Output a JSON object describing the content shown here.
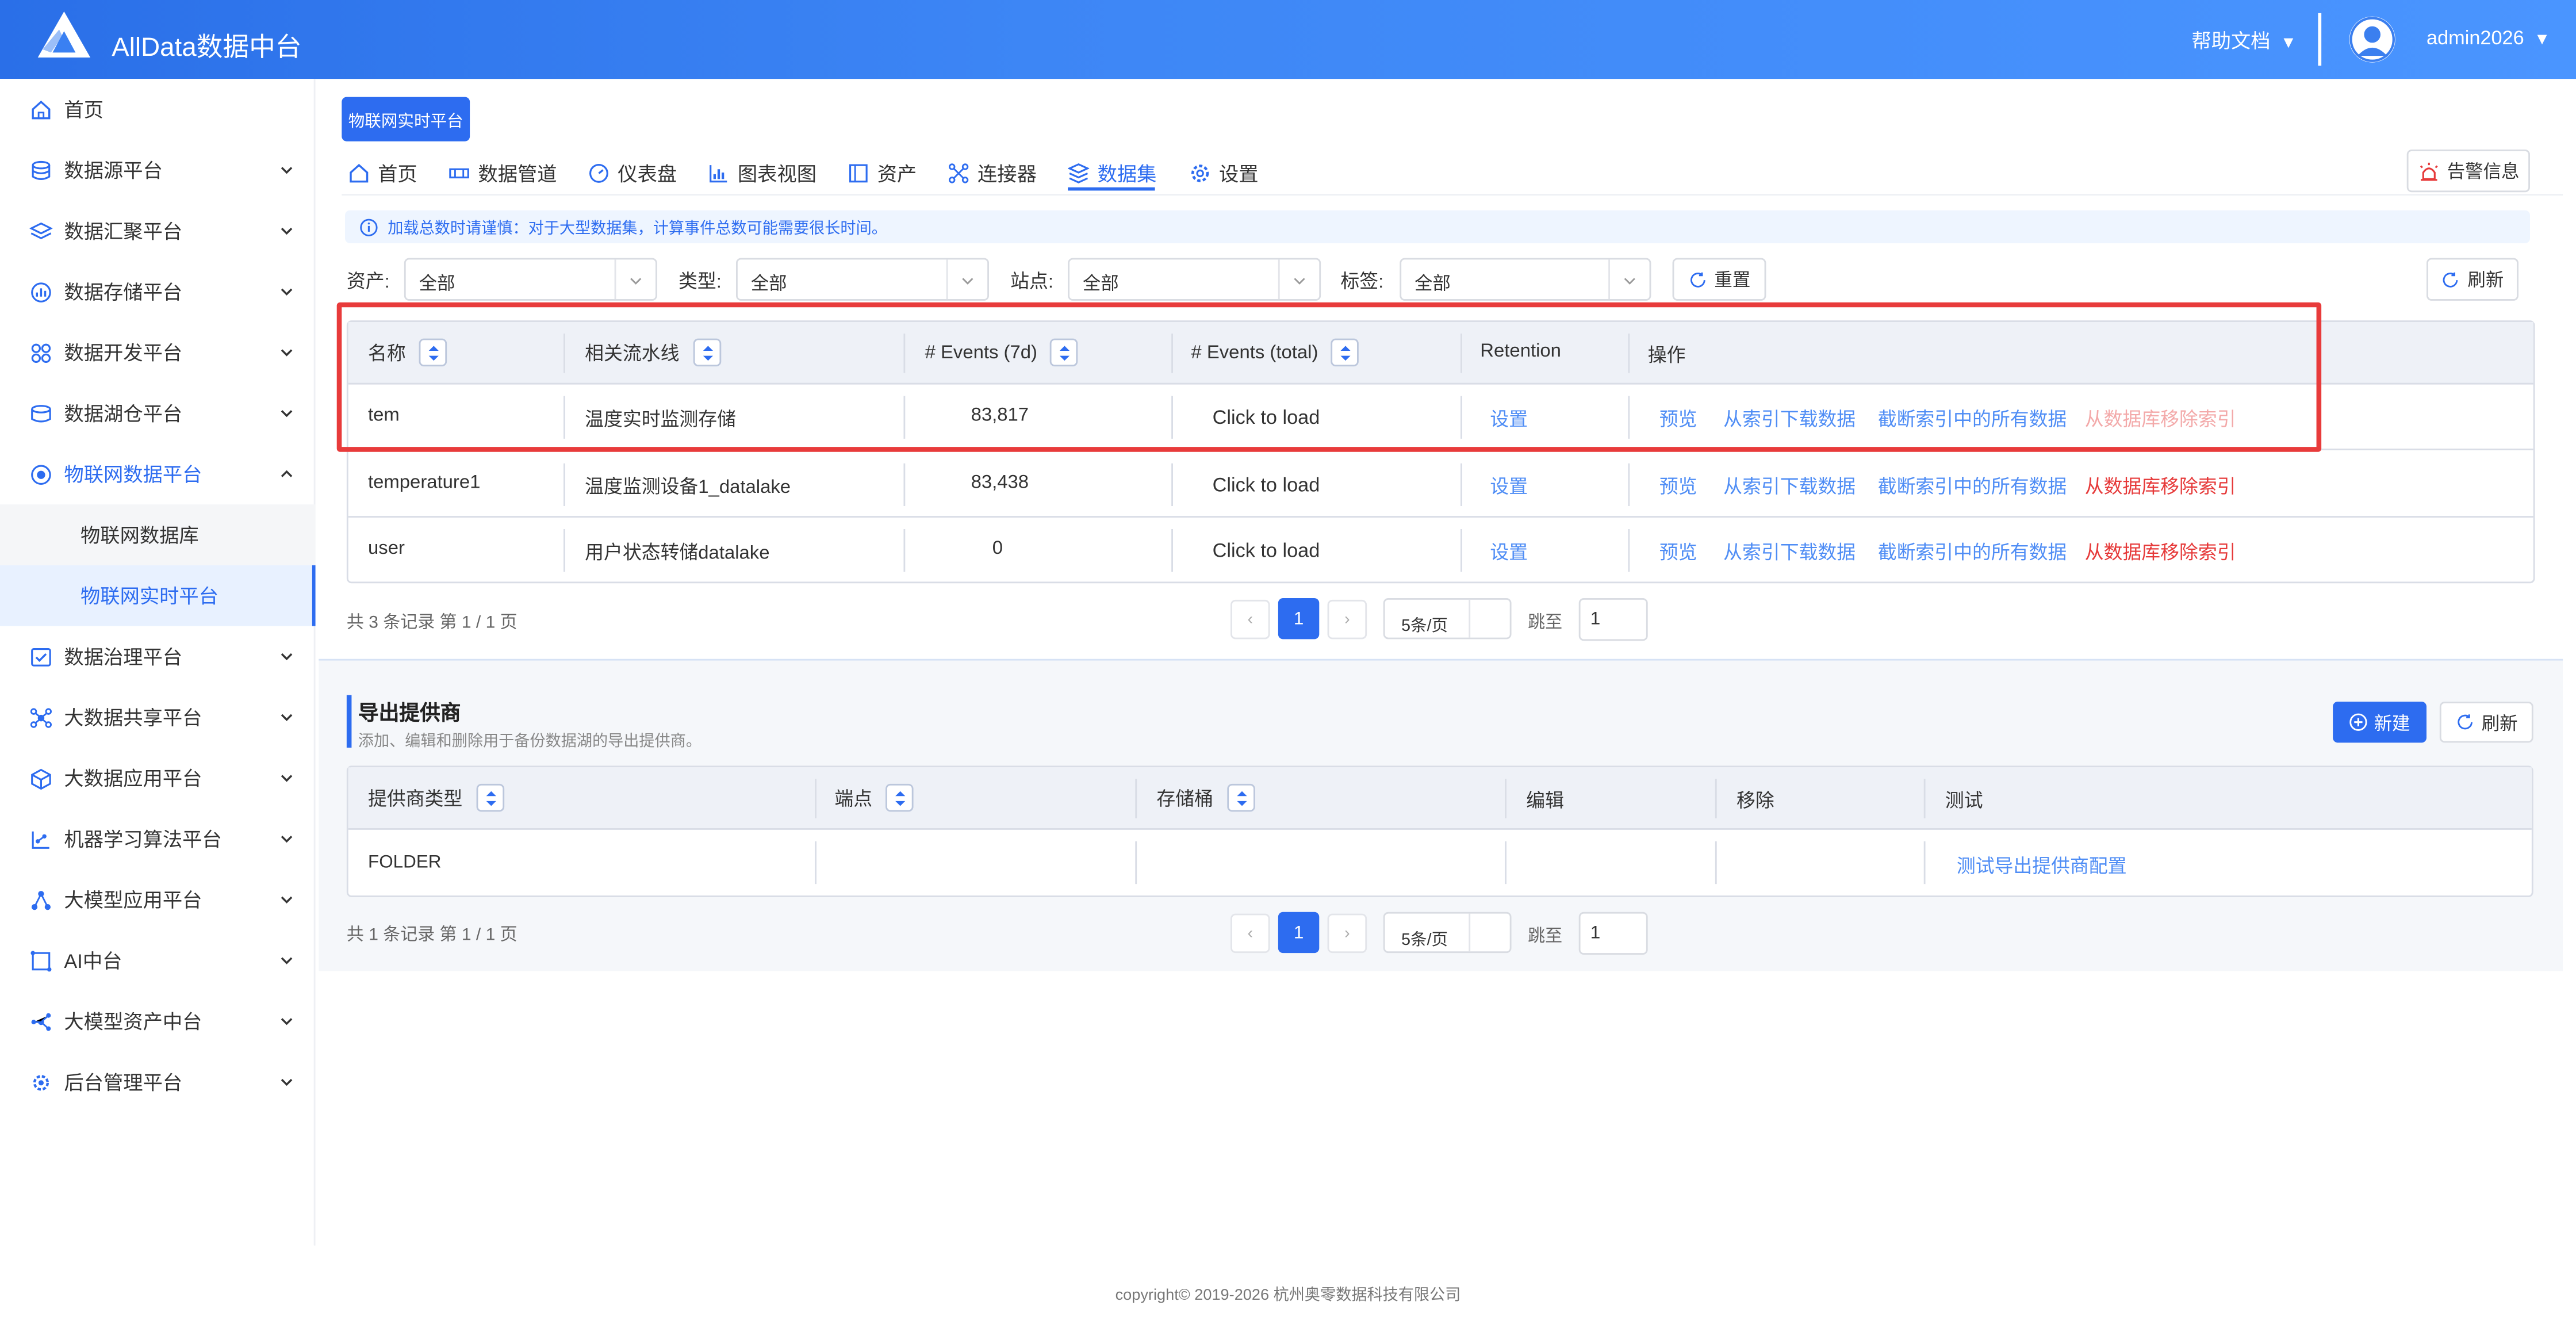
{
  "header": {
    "app_title": "AllData数据中台",
    "help_label": "帮助文档",
    "username": "admin2026"
  },
  "sidebar": {
    "items": [
      {
        "label": "首页",
        "icon": "home-icon"
      },
      {
        "label": "数据源平台",
        "icon": "database-icon"
      },
      {
        "label": "数据汇聚平台",
        "icon": "layers-icon"
      },
      {
        "label": "数据存储平台",
        "icon": "chart-icon"
      },
      {
        "label": "数据开发平台",
        "icon": "grid-icon"
      },
      {
        "label": "数据湖仓平台",
        "icon": "warehouse-icon"
      },
      {
        "label": "物联网数据平台",
        "icon": "iot-icon"
      },
      {
        "label": "数据治理平台",
        "icon": "governance-icon"
      },
      {
        "label": "大数据共享平台",
        "icon": "share-icon"
      },
      {
        "label": "大数据应用平台",
        "icon": "cube-icon"
      },
      {
        "label": "机器学习算法平台",
        "icon": "ml-icon"
      },
      {
        "label": "大模型应用平台",
        "icon": "model-icon"
      },
      {
        "label": "AI中台",
        "icon": "ai-icon"
      },
      {
        "label": "大模型资产中台",
        "icon": "asset-icon"
      },
      {
        "label": "后台管理平台",
        "icon": "admin-icon"
      }
    ],
    "subitems": [
      {
        "label": "物联网数据库"
      },
      {
        "label": "物联网实时平台"
      }
    ]
  },
  "main": {
    "breadcrumb_chip": "物联网实时平台",
    "tabs": [
      {
        "label": "首页",
        "icon": "home-icon"
      },
      {
        "label": "数据管道",
        "icon": "pipeline-icon"
      },
      {
        "label": "仪表盘",
        "icon": "dashboard-icon"
      },
      {
        "label": "图表视图",
        "icon": "bar-chart-icon"
      },
      {
        "label": "资产",
        "icon": "asset-icon"
      },
      {
        "label": "连接器",
        "icon": "connector-icon"
      },
      {
        "label": "数据集",
        "icon": "dataset-icon"
      },
      {
        "label": "设置",
        "icon": "gear-icon"
      }
    ],
    "alarm_label": "告警信息",
    "notice": "加载总数时请谨慎：对于大型数据集，计算事件总数可能需要很长时间。",
    "filters": {
      "asset_label": "资产:",
      "asset_value": "全部",
      "type_label": "类型:",
      "type_value": "全部",
      "site_label": "站点:",
      "site_value": "全部",
      "tag_label": "标签:",
      "tag_value": "全部",
      "reset_label": "重置",
      "refresh_label": "刷新"
    },
    "dataset_table": {
      "columns": [
        "名称",
        "相关流水线",
        "# Events (7d)",
        "# Events (total)",
        "Retention",
        "操作"
      ],
      "rows": [
        {
          "name": "tem",
          "pipeline": "温度实时监测存储",
          "events7d": "83,817",
          "total": "Click to load",
          "retention": "设置"
        },
        {
          "name": "temperature1",
          "pipeline": "温度监测设备1_datalake",
          "events7d": "83,438",
          "total": "Click to load",
          "retention": "设置"
        },
        {
          "name": "user",
          "pipeline": "用户状态转储datalake",
          "events7d": "0",
          "total": "Click to load",
          "retention": "设置"
        }
      ],
      "actions": {
        "preview": "预览",
        "download": "从索引下载数据",
        "truncate": "截断索引中的所有数据",
        "remove": "从数据库移除索引"
      },
      "pagination": {
        "summary": "共 3 条记录 第 1 / 1 页",
        "prev": "‹",
        "next": "›",
        "current": "1",
        "page_size": "5条/页",
        "jump_label": "跳至",
        "jump_value": "1"
      }
    },
    "export_section": {
      "title": "导出提供商",
      "subtitle": "添加、编辑和删除用于备份数据湖的导出提供商。",
      "new_label": "新建",
      "refresh_label": "刷新",
      "columns": [
        "提供商类型",
        "端点",
        "存储桶",
        "编辑",
        "移除",
        "测试"
      ],
      "rows": [
        {
          "type": "FOLDER",
          "test": "测试导出提供商配置"
        }
      ],
      "pagination": {
        "summary": "共 1 条记录 第 1 / 1 页",
        "prev": "‹",
        "next": "›",
        "current": "1",
        "page_size": "5条/页",
        "jump_label": "跳至",
        "jump_value": "1"
      }
    }
  },
  "footer": {
    "copyright": "copyright© 2019-2026 杭州奥零数据科技有限公司"
  },
  "colors": {
    "primary": "#2d6cf0",
    "link": "#4f8df5",
    "danger": "#e63a3a",
    "highlight_border": "#e83b3b"
  }
}
